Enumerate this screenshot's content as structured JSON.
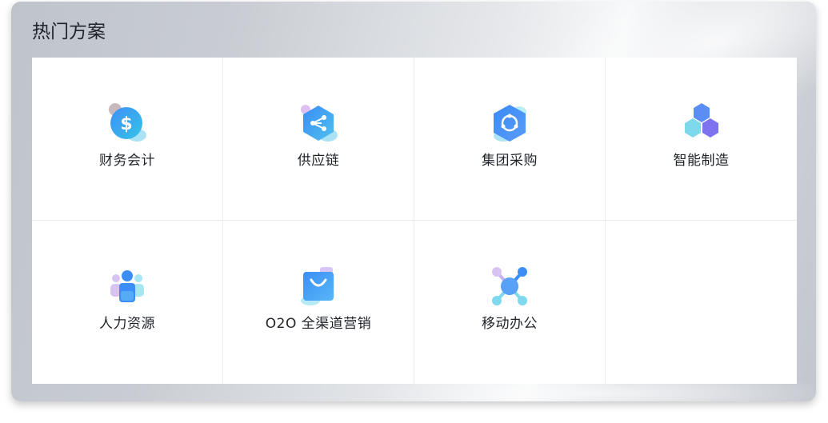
{
  "panel": {
    "title": "热门方案"
  },
  "solutions": [
    {
      "label": "财务会计",
      "icon": "dollar-coin-icon"
    },
    {
      "label": "供应链",
      "icon": "share-hexagon-icon"
    },
    {
      "label": "集团采购",
      "icon": "cycle-hexagon-icon"
    },
    {
      "label": "智能制造",
      "icon": "hexagon-cluster-icon"
    },
    {
      "label": "人力资源",
      "icon": "people-group-icon"
    },
    {
      "label": "O2O 全渠道营销",
      "icon": "shopping-bag-icon"
    },
    {
      "label": "移动办公",
      "icon": "network-nodes-icon"
    }
  ],
  "colors": {
    "accent_blue": "#3a8ef6",
    "accent_cyan": "#5fd3e8",
    "accent_purple": "#8b7cf6",
    "title_text": "#1f2329"
  }
}
